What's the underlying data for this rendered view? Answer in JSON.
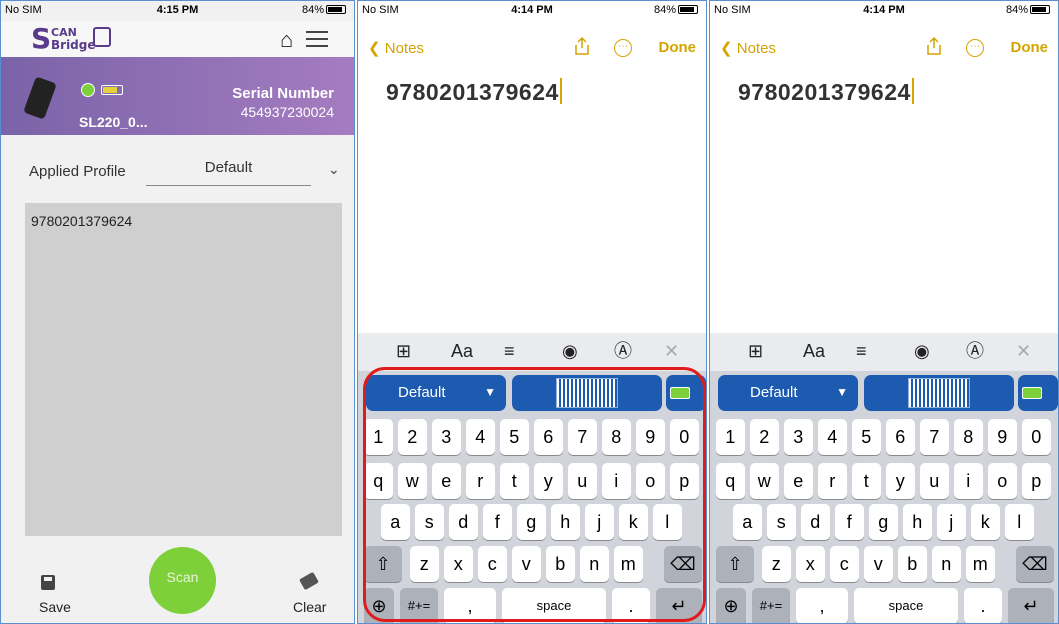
{
  "scanbridge": {
    "status": {
      "carrier": "No SIM",
      "time": "4:15 PM",
      "battery": "84%"
    },
    "logo": {
      "letter": "S",
      "top": "CAN",
      "bottom": "Bridge"
    },
    "device": {
      "name": "SL220_0...",
      "serial_label": "Serial Number",
      "serial_value": "454937230024"
    },
    "profile_label": "Applied Profile",
    "profile_value": "Default",
    "scanned_text": "9780201379624",
    "save_label": "Save",
    "scan_label": "Scan",
    "clear_label": "Clear"
  },
  "notes_a": {
    "status": {
      "carrier": "No SIM",
      "time": "4:14 PM",
      "battery": "84%"
    },
    "back": "Notes",
    "done": "Done",
    "text": "9780201379624",
    "toolbar": {
      "aa": "Aa"
    },
    "profile": "Default"
  },
  "notes_b": {
    "status": {
      "carrier": "No SIM",
      "time": "4:14 PM",
      "battery": "84%"
    },
    "back": "Notes",
    "done": "Done",
    "text": "9780201379624",
    "toolbar": {
      "aa": "Aa"
    },
    "profile": "Default"
  },
  "keyboard": {
    "row1": [
      "1",
      "2",
      "3",
      "4",
      "5",
      "6",
      "7",
      "8",
      "9",
      "0"
    ],
    "row2": [
      "q",
      "w",
      "e",
      "r",
      "t",
      "y",
      "u",
      "i",
      "o",
      "p"
    ],
    "row3": [
      "a",
      "s",
      "d",
      "f",
      "g",
      "h",
      "j",
      "k",
      "l"
    ],
    "row4": [
      "z",
      "x",
      "c",
      "v",
      "b",
      "n",
      "m"
    ],
    "symbols": "#+=",
    "comma": ",",
    "space": "space",
    "period": "."
  },
  "colors": {
    "accent": "#d4a400",
    "scan_green": "#7ed03a",
    "brand_purple": "#7a63a8",
    "kb_blue": "#1c5bb0",
    "highlight": "#e01b1b"
  }
}
